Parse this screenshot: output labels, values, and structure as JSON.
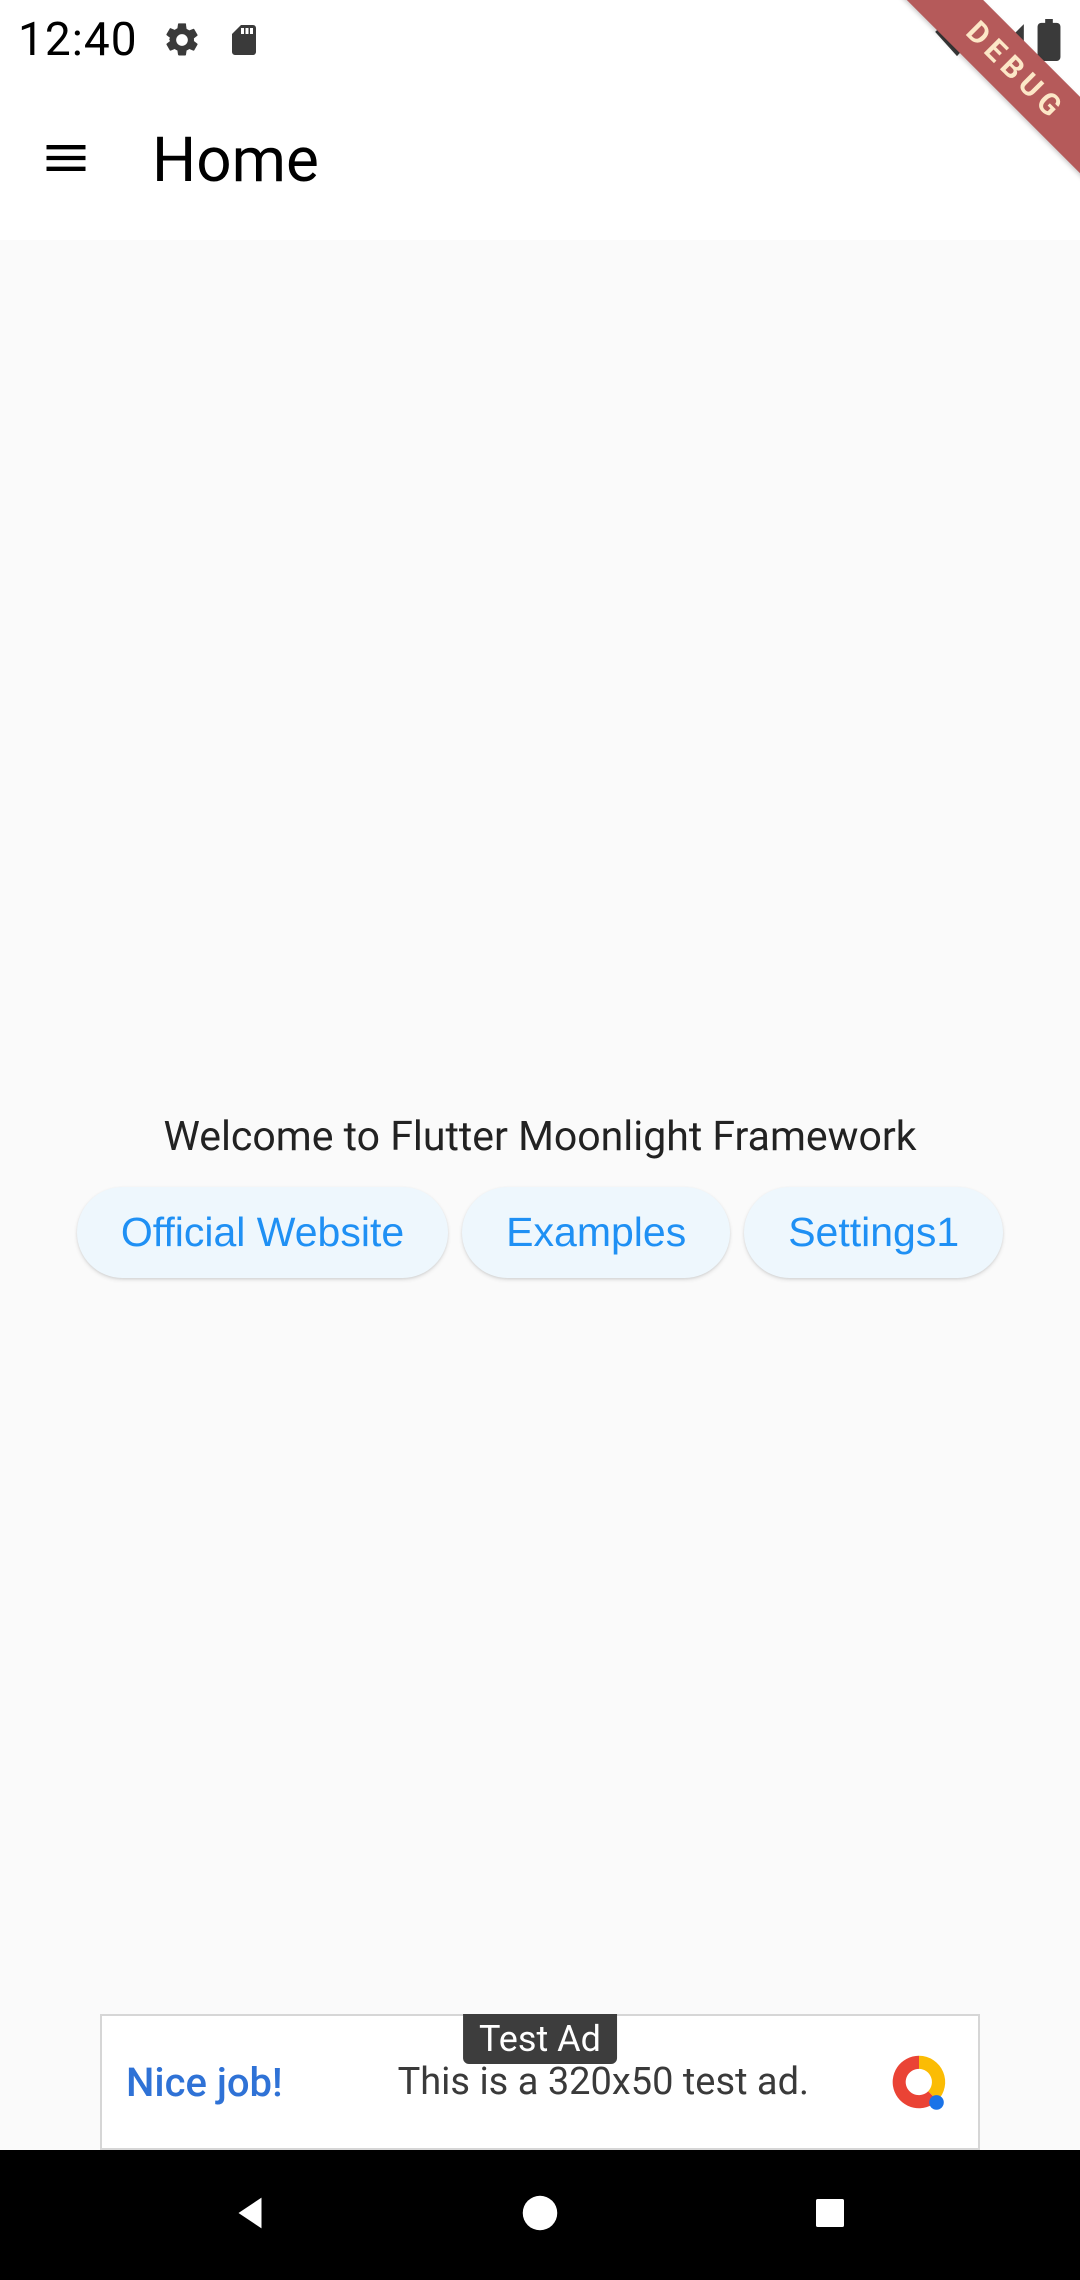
{
  "status_bar": {
    "time": "12:40",
    "icons": {
      "settings": "gear-icon",
      "sd": "sd-card-icon",
      "wifi": "wifi-icon",
      "signal": "cell-signal-icon",
      "battery": "battery-icon"
    }
  },
  "debug_banner": "DEBUG",
  "app_bar": {
    "menu_icon": "hamburger-icon",
    "title": "Home"
  },
  "main": {
    "welcome": "Welcome to Flutter Moonlight Framework",
    "buttons": [
      {
        "label": "Official Website"
      },
      {
        "label": "Examples"
      },
      {
        "label": "Settings1"
      }
    ]
  },
  "ad": {
    "badge": "Test Ad",
    "left_text": "Nice job!",
    "description": "This is a 320x50 test ad.",
    "logo": "admob-logo"
  },
  "nav": {
    "back": "back-triangle-icon",
    "home": "home-circle-icon",
    "recent": "recent-square-icon"
  },
  "colors": {
    "accent_blue": "#1f90f4",
    "pill_bg": "#eef7fd",
    "debug_bg": "#b55a5a",
    "body_bg": "#fafafa"
  }
}
